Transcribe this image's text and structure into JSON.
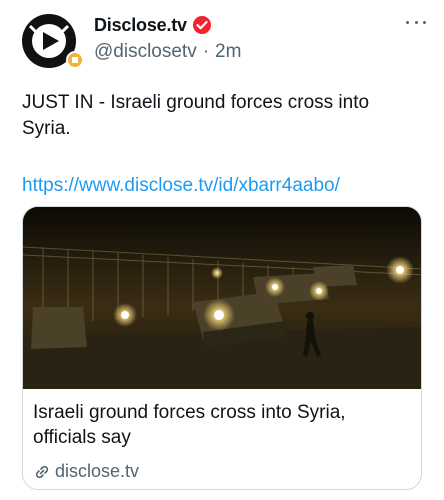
{
  "author": {
    "display_name": "Disclose.tv",
    "handle": "@disclosetv",
    "separator": "·",
    "timestamp": "2m",
    "avatar_icon": "disclose-play-logo",
    "verified_color": "#f4212e"
  },
  "tweet": {
    "text": "JUST IN - Israeli ground forces cross into Syria.",
    "link": "https://www.disclose.tv/id/xbarr4aabo/"
  },
  "card": {
    "image_description_icon": "military-vehicles-night-photo",
    "title": "Israeli ground forces cross into Syria, officials say",
    "domain": "disclose.tv"
  },
  "colors": {
    "link": "#1d9bf0",
    "secondary_text": "#536471",
    "border": "#cfd9de"
  }
}
